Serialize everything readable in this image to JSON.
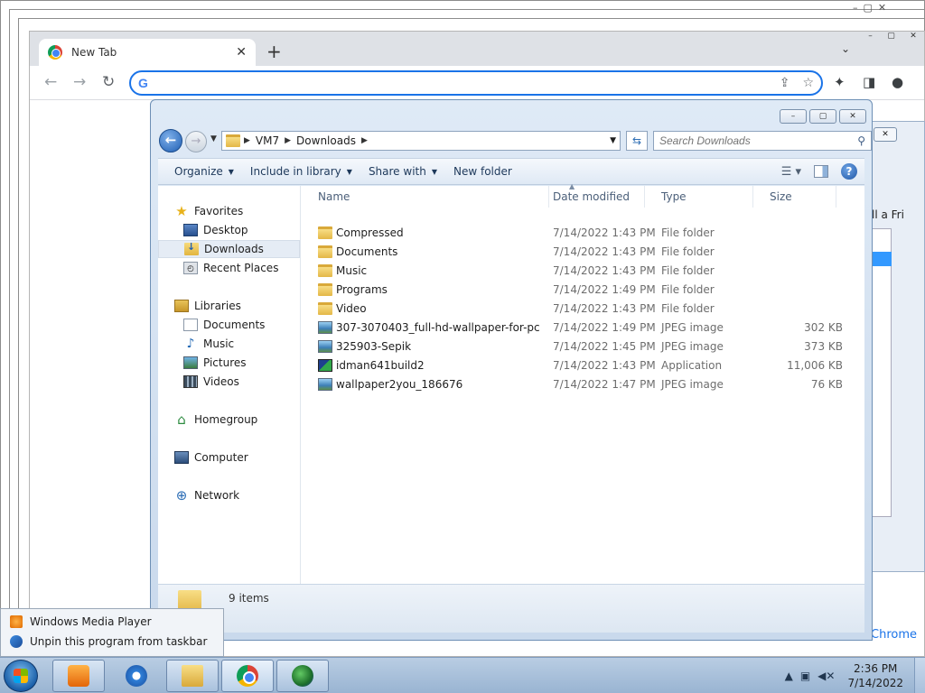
{
  "chrome": {
    "tab_title": "New Tab",
    "tab_close": "✕",
    "new_tab": "+",
    "tab_list": "⌄",
    "omnibox_value": "",
    "omnibox_icon": "G",
    "bottom_link": "e Chrome",
    "window_controls": [
      "–",
      "▢",
      "✕"
    ]
  },
  "explorer": {
    "window_controls": [
      "–",
      "▢",
      "✕"
    ],
    "breadcrumbs": [
      "VM7",
      "Downloads"
    ],
    "search_placeholder": "Search Downloads",
    "commands": [
      {
        "label": "Organize",
        "dropdown": true
      },
      {
        "label": "Include in library",
        "dropdown": true
      },
      {
        "label": "Share with",
        "dropdown": true
      },
      {
        "label": "New folder",
        "dropdown": false
      }
    ],
    "help": "?",
    "nav": {
      "favorites": {
        "label": "Favorites",
        "items": [
          "Desktop",
          "Downloads",
          "Recent Places"
        ]
      },
      "libraries": {
        "label": "Libraries",
        "items": [
          "Documents",
          "Music",
          "Pictures",
          "Videos"
        ]
      },
      "homegroup": "Homegroup",
      "computer": "Computer",
      "network": "Network"
    },
    "columns": [
      "Name",
      "Date modified",
      "Type",
      "Size"
    ],
    "files": [
      {
        "name": "Compressed",
        "date": "7/14/2022 1:43 PM",
        "type": "File folder",
        "size": "",
        "icon": "folder"
      },
      {
        "name": "Documents",
        "date": "7/14/2022 1:43 PM",
        "type": "File folder",
        "size": "",
        "icon": "folder"
      },
      {
        "name": "Music",
        "date": "7/14/2022 1:43 PM",
        "type": "File folder",
        "size": "",
        "icon": "folder"
      },
      {
        "name": "Programs",
        "date": "7/14/2022 1:49 PM",
        "type": "File folder",
        "size": "",
        "icon": "folder"
      },
      {
        "name": "Video",
        "date": "7/14/2022 1:43 PM",
        "type": "File folder",
        "size": "",
        "icon": "folder"
      },
      {
        "name": "307-3070403_full-hd-wallpaper-for-pc",
        "date": "7/14/2022 1:49 PM",
        "type": "JPEG image",
        "size": "302 KB",
        "icon": "jpeg"
      },
      {
        "name": "325903-Sepik",
        "date": "7/14/2022 1:45 PM",
        "type": "JPEG image",
        "size": "373 KB",
        "icon": "jpeg"
      },
      {
        "name": "idman641build2",
        "date": "7/14/2022 1:43 PM",
        "type": "Application",
        "size": "11,006 KB",
        "icon": "app"
      },
      {
        "name": "wallpaper2you_186676",
        "date": "7/14/2022 1:47 PM",
        "type": "JPEG image",
        "size": "76 KB",
        "icon": "jpeg"
      }
    ],
    "item_count": "9 items"
  },
  "right_window": {
    "partial_text": "ll a Fri"
  },
  "jumplist": {
    "items": [
      {
        "label": "Windows Media Player",
        "icon": "wmp-icon"
      },
      {
        "label": "Unpin this program from taskbar",
        "icon": "unpin-icon"
      }
    ]
  },
  "taskbar": {
    "apps": [
      "windows-media-player",
      "internet-explorer",
      "windows-explorer",
      "google-chrome",
      "internet-download-manager"
    ],
    "clock_time": "2:36 PM",
    "clock_date": "7/14/2022"
  }
}
